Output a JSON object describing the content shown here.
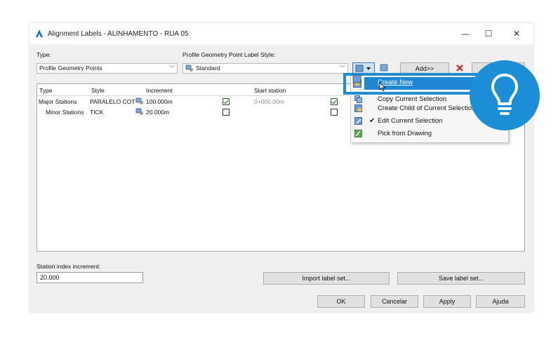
{
  "window": {
    "title": "Alignment Labels - ALINHAMENTO - RUA 05",
    "minimize_glyph": "—",
    "maximize_glyph": "☐",
    "close_glyph": "✕"
  },
  "type_section": {
    "label": "Type:",
    "value": "Profile Geometry Points"
  },
  "style_section": {
    "label": "Profile Geometry Point Label Style:",
    "value": "Standard"
  },
  "add_button": {
    "label": "Add>>"
  },
  "grid": {
    "headers": [
      "Type",
      "Style",
      "Increment",
      "Start station"
    ],
    "rows": [
      {
        "type": "Major Stations",
        "style": "PARALELO COT",
        "increment": "100.000m",
        "visible": true,
        "start": "0+000.00m",
        "dim": true
      },
      {
        "type": "Minor Stations",
        "style": "TICK",
        "increment": "20.000m",
        "visible": false,
        "start": "",
        "dim": false
      }
    ]
  },
  "context_menu": {
    "items": [
      {
        "label": "Create New",
        "icon": "create-new-icon",
        "selected": true
      },
      {
        "label": "Copy Current Selection",
        "icon": "copy-icon"
      },
      {
        "label": "Create Child of Current Selection",
        "icon": "create-child-icon"
      },
      {
        "label": "Edit Current Selection",
        "icon": "edit-icon",
        "checked": true
      },
      {
        "label": "Pick from Drawing",
        "icon": "pick-icon"
      }
    ]
  },
  "station_index": {
    "label": "Station index increment:",
    "value": "20.000"
  },
  "buttons": {
    "import": "Import label set...",
    "save": "Save label set...",
    "ok": "OK",
    "cancel": "Cancelar",
    "apply": "Apply",
    "help": "Ajuda"
  },
  "colors": {
    "highlight": "#1f8dd0",
    "bulb": "#1c8ed6",
    "menu_selected": "#1d86d5"
  },
  "overlay": {
    "icon": "lightbulb-icon"
  }
}
